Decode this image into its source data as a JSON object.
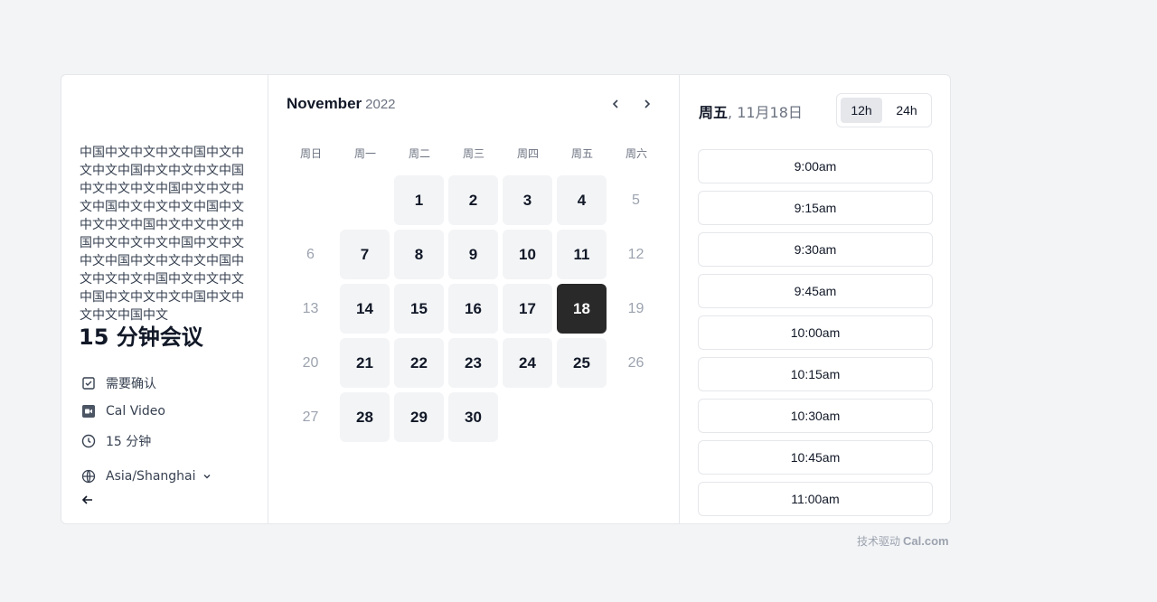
{
  "event": {
    "description": "中国中文中文中文中国中文中文中文中国中文中文中文中国中文中文中文中国中文中文中文中国中文中文中文中国中文中文中文中国中文中文中文中国中文中文中文中国中文中文中文中国中文中文中文中国中文中文中文中国中文中文中文中国中文中文中文中国中文中文中文中国中文",
    "title": "15 分钟会议",
    "requires_confirmation": "需要确认",
    "location": "Cal Video",
    "duration": "15 分钟",
    "timezone": "Asia/Shanghai"
  },
  "calendar": {
    "month": "November",
    "year": "2022",
    "weekdays": [
      "周日",
      "周一",
      "周二",
      "周三",
      "周四",
      "周五",
      "周六"
    ],
    "days": [
      "1",
      "2",
      "3",
      "4",
      "5",
      "6",
      "7",
      "8",
      "9",
      "10",
      "11",
      "12",
      "13",
      "14",
      "15",
      "16",
      "17",
      "18",
      "19",
      "20",
      "21",
      "22",
      "23",
      "24",
      "25",
      "26",
      "27",
      "28",
      "29",
      "30"
    ],
    "selected_day": "18"
  },
  "times": {
    "weekday": "周五",
    "date": ", 11月18日",
    "toggle_12h": "12h",
    "toggle_24h": "24h",
    "format_selected": "12h",
    "slots": [
      "9:00am",
      "9:15am",
      "9:30am",
      "9:45am",
      "10:00am",
      "10:15am",
      "10:30am",
      "10:45am",
      "11:00am"
    ]
  },
  "footer": {
    "powered_by": "技术驱动",
    "brand": "Cal.com"
  },
  "colors": {
    "selected_day": "#292929",
    "available_day": "#f3f4f6",
    "page_bg": "#f3f4f6"
  }
}
